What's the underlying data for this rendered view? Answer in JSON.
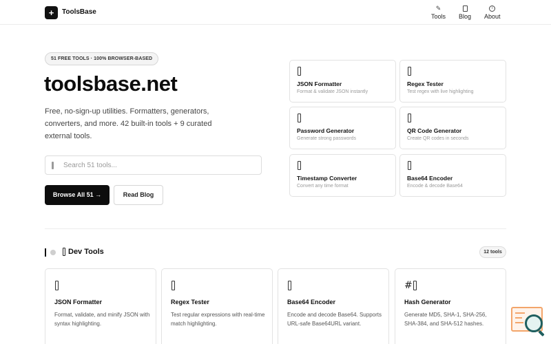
{
  "header": {
    "logo_glyph": "+",
    "brand": "ToolsBase",
    "nav": [
      {
        "label": "Tools",
        "icon": "pen-icon"
      },
      {
        "label": "Blog",
        "icon": "book-icon"
      },
      {
        "label": "About",
        "icon": "info-icon"
      }
    ]
  },
  "hero": {
    "badge": "51 FREE TOOLS · 100% BROWSER-BASED",
    "title": "toolsbase.net",
    "description": "Free, no-sign-up utilities. Formatters, generators, converters, and more. 42 built-in tools + 9 curated external tools.",
    "search_placeholder": "Search 51 tools...",
    "browse_button": "Browse All 51 →",
    "blog_button": "Read Blog"
  },
  "featured": [
    {
      "title": "JSON Formatter",
      "desc": "Format & validate JSON instantly"
    },
    {
      "title": "Regex Tester",
      "desc": "Test regex with live highlighting"
    },
    {
      "title": "Password Generator",
      "desc": "Generate strong passwords"
    },
    {
      "title": "QR Code Generator",
      "desc": "Create QR codes in seconds"
    },
    {
      "title": "Timestamp Converter",
      "desc": "Convert any time format"
    },
    {
      "title": "Base64 Encoder",
      "desc": "Encode & decode Base64"
    }
  ],
  "section": {
    "title": "Dev Tools",
    "count": "12 tools",
    "tools": [
      {
        "icon_glyph": "",
        "title": "JSON Formatter",
        "desc": "Format, validate, and minify JSON with syntax highlighting."
      },
      {
        "icon_glyph": "",
        "title": "Regex Tester",
        "desc": "Test regular expressions with real-time match highlighting."
      },
      {
        "icon_glyph": "",
        "title": "Base64 Encoder",
        "desc": "Encode and decode Base64. Supports URL-safe Base64URL variant."
      },
      {
        "icon_glyph": "#",
        "title": "Hash Generator",
        "desc": "Generate MD5, SHA-1, SHA-256, SHA-384, and SHA-512 hashes."
      }
    ]
  },
  "colors": {
    "accent": "#0d0d0d",
    "widget_orange": "#f3a56a",
    "widget_teal": "#1f5f5f"
  }
}
